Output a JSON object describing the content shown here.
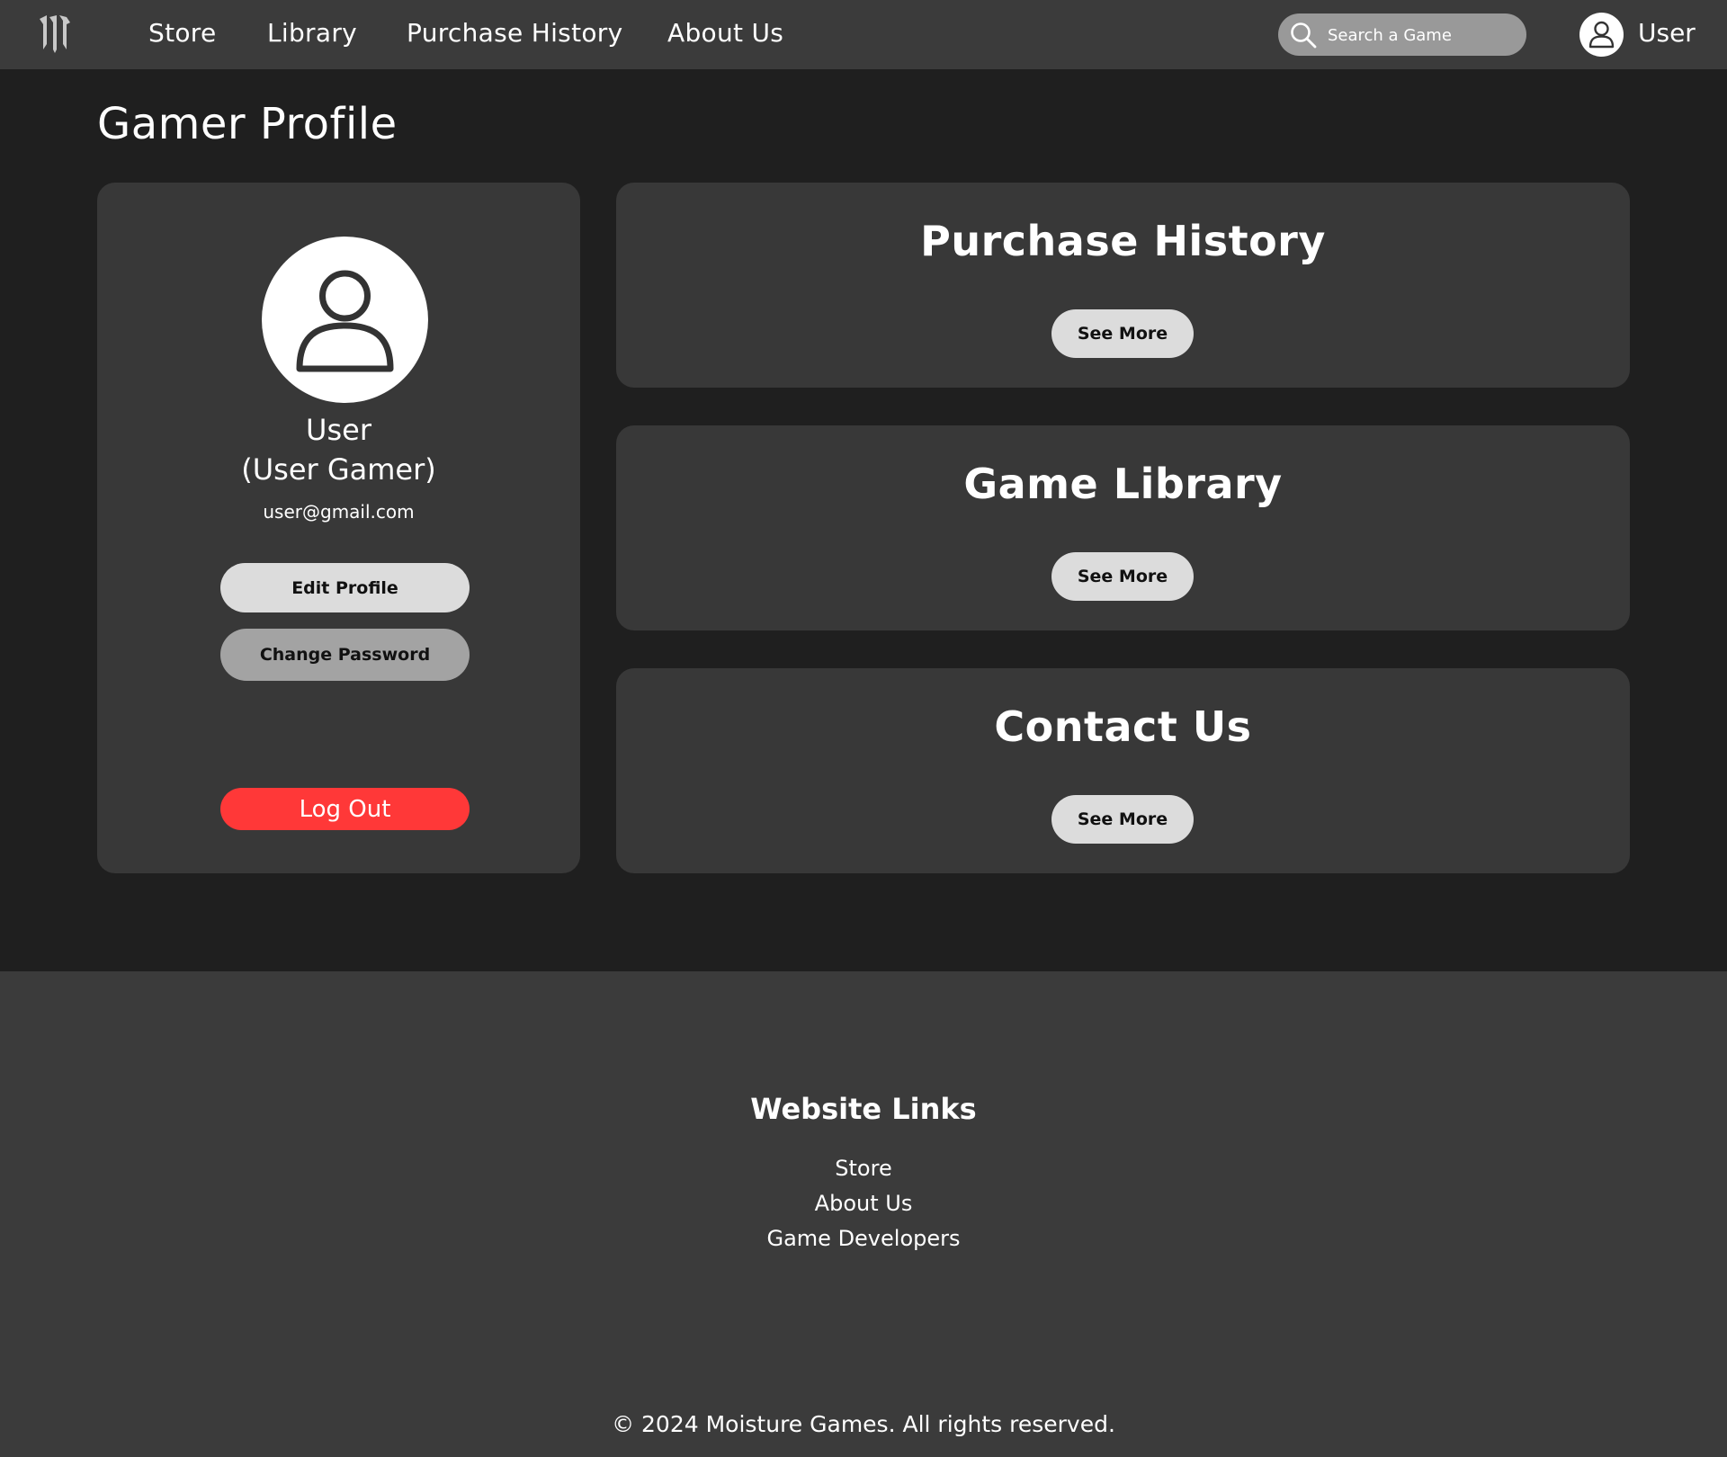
{
  "nav": {
    "logo_icon": "moisture-games-logo",
    "items": [
      {
        "label": "Store"
      },
      {
        "label": "Library"
      },
      {
        "label": "Purchase History"
      },
      {
        "label": "About Us"
      }
    ],
    "search": {
      "placeholder": "Search a Game",
      "value": "",
      "icon": "search-icon"
    },
    "user": {
      "label": "User",
      "icon": "user-icon"
    }
  },
  "main": {
    "title": "Gamer Profile",
    "profile": {
      "avatar_icon": "user-icon",
      "name": "User",
      "role": "(User Gamer)",
      "email": "user@gmail.com",
      "edit_label": "Edit Profile",
      "password_label": "Change Password",
      "logout_label": "Log Out"
    },
    "sections": [
      {
        "title": "Purchase History",
        "button": "See More"
      },
      {
        "title": "Game Library",
        "button": "See More"
      },
      {
        "title": "Contact Us",
        "button": "See More"
      }
    ]
  },
  "footer": {
    "heading": "Website Links",
    "links": [
      {
        "label": "Store"
      },
      {
        "label": "About Us"
      },
      {
        "label": "Game Developers"
      }
    ],
    "copyright": "© 2024 Moisture Games. All rights reserved."
  },
  "colors": {
    "page_bg": "#1f1f1f",
    "bar_bg": "#3b3b3b",
    "card_bg": "#383838",
    "button_light": "#dcdcdc",
    "button_grey": "#a3a3a3",
    "logout_red": "#ff3838"
  }
}
